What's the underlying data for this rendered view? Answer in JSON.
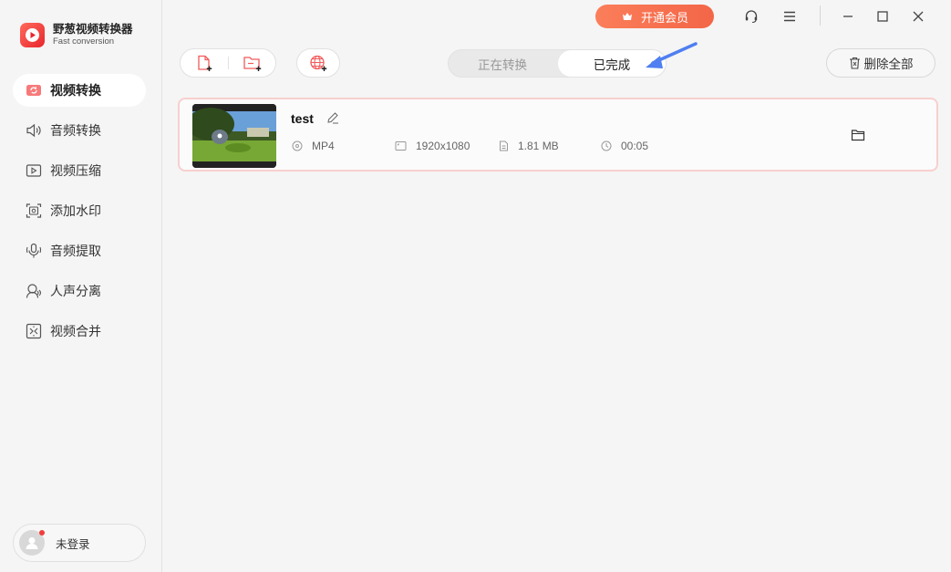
{
  "app": {
    "title": "野葱视频转换器",
    "subtitle": "Fast conversion",
    "logo_color": "#e8262c"
  },
  "sidebar": {
    "items": [
      {
        "label": "视频转换",
        "icon": "video-convert-icon",
        "active": true
      },
      {
        "label": "音频转换",
        "icon": "speaker-icon",
        "active": false
      },
      {
        "label": "视频压缩",
        "icon": "video-compress-icon",
        "active": false
      },
      {
        "label": "添加水印",
        "icon": "watermark-icon",
        "active": false
      },
      {
        "label": "音频提取",
        "icon": "microphone-icon",
        "active": false
      },
      {
        "label": "人声分离",
        "icon": "voice-separate-icon",
        "active": false
      },
      {
        "label": "视频合并",
        "icon": "merge-icon",
        "active": false
      }
    ],
    "user": {
      "label": "未登录"
    }
  },
  "titlebar": {
    "vip_label": "开通会员",
    "vip_color": "#f36648"
  },
  "toolbar": {
    "tabs": [
      {
        "label": "正在转换",
        "active": false
      },
      {
        "label": "已完成",
        "active": true
      }
    ],
    "delete_all_label": "删除全部"
  },
  "files": [
    {
      "name": "test",
      "format": "MP4",
      "resolution": "1920x1080",
      "size": "1.81 MB",
      "duration": "00:05"
    }
  ],
  "accent_color": "#f8cfcf"
}
